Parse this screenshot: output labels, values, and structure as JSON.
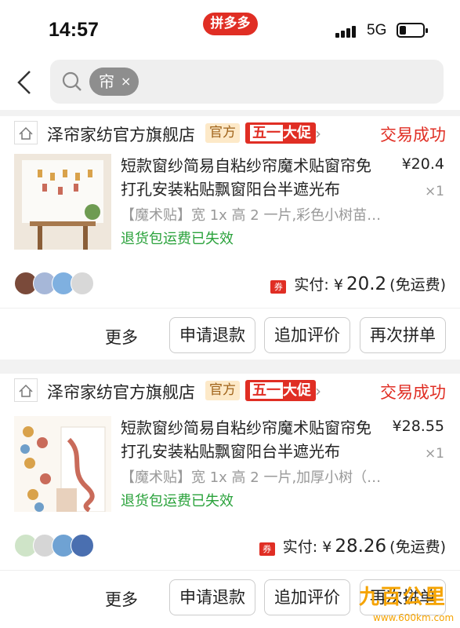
{
  "status_bar": {
    "time": "14:57",
    "app_name": "拼多多",
    "network": "5G",
    "battery_level": 0.3
  },
  "search": {
    "keyword_chip": "帘",
    "chip_close": "×"
  },
  "orders": [
    {
      "shop_name": "泽帘家纺官方旗舰店",
      "tag_official": "官方",
      "tag_promo": "五一大促",
      "status": "交易成功",
      "title": "短款窗纱简易自粘纱帘魔术贴窗帘免打孔安装粘贴飘窗阳台半遮光布",
      "price": "¥20.4",
      "qty": "×1",
      "spec": "【魔术贴】宽 1x 高 2 一片,彩色小树苗…",
      "notice": "退货包运费已失效",
      "coupon_icon": "券",
      "paid_label": "实付: ¥",
      "paid_amount": "20.2",
      "shipping": "(免运费)",
      "btn_more": "更多",
      "btn_refund": "申请退款",
      "btn_review": "追加评价",
      "btn_reorder": "再次拼单"
    },
    {
      "shop_name": "泽帘家纺官方旗舰店",
      "tag_official": "官方",
      "tag_promo": "五一大促",
      "status": "交易成功",
      "title": "短款窗纱简易自粘纱帘魔术贴窗帘免打孔安装粘贴飘窗阳台半遮光布",
      "price": "¥28.55",
      "qty": "×1",
      "spec": "【魔术贴】宽 1x 高 2 一片,加厚小树（…",
      "notice": "退货包运费已失效",
      "coupon_icon": "券",
      "paid_label": "实付: ¥",
      "paid_amount": "28.26",
      "shipping": "(免运费)",
      "btn_more": "更多",
      "btn_refund": "申请退款",
      "btn_review": "追加评价",
      "btn_reorder": "再次拼单"
    }
  ],
  "watermark": {
    "logo": "九百公里",
    "url": "www.600km.com"
  },
  "colors": {
    "brand_red": "#e02e24",
    "success_green": "#2aa23b",
    "official_tag_bg": "#fde9c8"
  }
}
